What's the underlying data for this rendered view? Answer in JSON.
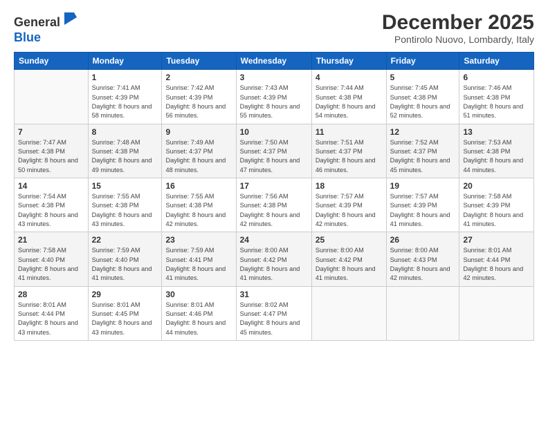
{
  "logo": {
    "general": "General",
    "blue": "Blue"
  },
  "header": {
    "month": "December 2025",
    "location": "Pontirolo Nuovo, Lombardy, Italy"
  },
  "weekdays": [
    "Sunday",
    "Monday",
    "Tuesday",
    "Wednesday",
    "Thursday",
    "Friday",
    "Saturday"
  ],
  "weeks": [
    [
      {
        "day": "",
        "sunrise": "",
        "sunset": "",
        "daylight": ""
      },
      {
        "day": "1",
        "sunrise": "Sunrise: 7:41 AM",
        "sunset": "Sunset: 4:39 PM",
        "daylight": "Daylight: 8 hours and 58 minutes."
      },
      {
        "day": "2",
        "sunrise": "Sunrise: 7:42 AM",
        "sunset": "Sunset: 4:39 PM",
        "daylight": "Daylight: 8 hours and 56 minutes."
      },
      {
        "day": "3",
        "sunrise": "Sunrise: 7:43 AM",
        "sunset": "Sunset: 4:39 PM",
        "daylight": "Daylight: 8 hours and 55 minutes."
      },
      {
        "day": "4",
        "sunrise": "Sunrise: 7:44 AM",
        "sunset": "Sunset: 4:38 PM",
        "daylight": "Daylight: 8 hours and 54 minutes."
      },
      {
        "day": "5",
        "sunrise": "Sunrise: 7:45 AM",
        "sunset": "Sunset: 4:38 PM",
        "daylight": "Daylight: 8 hours and 52 minutes."
      },
      {
        "day": "6",
        "sunrise": "Sunrise: 7:46 AM",
        "sunset": "Sunset: 4:38 PM",
        "daylight": "Daylight: 8 hours and 51 minutes."
      }
    ],
    [
      {
        "day": "7",
        "sunrise": "Sunrise: 7:47 AM",
        "sunset": "Sunset: 4:38 PM",
        "daylight": "Daylight: 8 hours and 50 minutes."
      },
      {
        "day": "8",
        "sunrise": "Sunrise: 7:48 AM",
        "sunset": "Sunset: 4:38 PM",
        "daylight": "Daylight: 8 hours and 49 minutes."
      },
      {
        "day": "9",
        "sunrise": "Sunrise: 7:49 AM",
        "sunset": "Sunset: 4:37 PM",
        "daylight": "Daylight: 8 hours and 48 minutes."
      },
      {
        "day": "10",
        "sunrise": "Sunrise: 7:50 AM",
        "sunset": "Sunset: 4:37 PM",
        "daylight": "Daylight: 8 hours and 47 minutes."
      },
      {
        "day": "11",
        "sunrise": "Sunrise: 7:51 AM",
        "sunset": "Sunset: 4:37 PM",
        "daylight": "Daylight: 8 hours and 46 minutes."
      },
      {
        "day": "12",
        "sunrise": "Sunrise: 7:52 AM",
        "sunset": "Sunset: 4:37 PM",
        "daylight": "Daylight: 8 hours and 45 minutes."
      },
      {
        "day": "13",
        "sunrise": "Sunrise: 7:53 AM",
        "sunset": "Sunset: 4:38 PM",
        "daylight": "Daylight: 8 hours and 44 minutes."
      }
    ],
    [
      {
        "day": "14",
        "sunrise": "Sunrise: 7:54 AM",
        "sunset": "Sunset: 4:38 PM",
        "daylight": "Daylight: 8 hours and 43 minutes."
      },
      {
        "day": "15",
        "sunrise": "Sunrise: 7:55 AM",
        "sunset": "Sunset: 4:38 PM",
        "daylight": "Daylight: 8 hours and 43 minutes."
      },
      {
        "day": "16",
        "sunrise": "Sunrise: 7:55 AM",
        "sunset": "Sunset: 4:38 PM",
        "daylight": "Daylight: 8 hours and 42 minutes."
      },
      {
        "day": "17",
        "sunrise": "Sunrise: 7:56 AM",
        "sunset": "Sunset: 4:38 PM",
        "daylight": "Daylight: 8 hours and 42 minutes."
      },
      {
        "day": "18",
        "sunrise": "Sunrise: 7:57 AM",
        "sunset": "Sunset: 4:39 PM",
        "daylight": "Daylight: 8 hours and 42 minutes."
      },
      {
        "day": "19",
        "sunrise": "Sunrise: 7:57 AM",
        "sunset": "Sunset: 4:39 PM",
        "daylight": "Daylight: 8 hours and 41 minutes."
      },
      {
        "day": "20",
        "sunrise": "Sunrise: 7:58 AM",
        "sunset": "Sunset: 4:39 PM",
        "daylight": "Daylight: 8 hours and 41 minutes."
      }
    ],
    [
      {
        "day": "21",
        "sunrise": "Sunrise: 7:58 AM",
        "sunset": "Sunset: 4:40 PM",
        "daylight": "Daylight: 8 hours and 41 minutes."
      },
      {
        "day": "22",
        "sunrise": "Sunrise: 7:59 AM",
        "sunset": "Sunset: 4:40 PM",
        "daylight": "Daylight: 8 hours and 41 minutes."
      },
      {
        "day": "23",
        "sunrise": "Sunrise: 7:59 AM",
        "sunset": "Sunset: 4:41 PM",
        "daylight": "Daylight: 8 hours and 41 minutes."
      },
      {
        "day": "24",
        "sunrise": "Sunrise: 8:00 AM",
        "sunset": "Sunset: 4:42 PM",
        "daylight": "Daylight: 8 hours and 41 minutes."
      },
      {
        "day": "25",
        "sunrise": "Sunrise: 8:00 AM",
        "sunset": "Sunset: 4:42 PM",
        "daylight": "Daylight: 8 hours and 41 minutes."
      },
      {
        "day": "26",
        "sunrise": "Sunrise: 8:00 AM",
        "sunset": "Sunset: 4:43 PM",
        "daylight": "Daylight: 8 hours and 42 minutes."
      },
      {
        "day": "27",
        "sunrise": "Sunrise: 8:01 AM",
        "sunset": "Sunset: 4:44 PM",
        "daylight": "Daylight: 8 hours and 42 minutes."
      }
    ],
    [
      {
        "day": "28",
        "sunrise": "Sunrise: 8:01 AM",
        "sunset": "Sunset: 4:44 PM",
        "daylight": "Daylight: 8 hours and 43 minutes."
      },
      {
        "day": "29",
        "sunrise": "Sunrise: 8:01 AM",
        "sunset": "Sunset: 4:45 PM",
        "daylight": "Daylight: 8 hours and 43 minutes."
      },
      {
        "day": "30",
        "sunrise": "Sunrise: 8:01 AM",
        "sunset": "Sunset: 4:46 PM",
        "daylight": "Daylight: 8 hours and 44 minutes."
      },
      {
        "day": "31",
        "sunrise": "Sunrise: 8:02 AM",
        "sunset": "Sunset: 4:47 PM",
        "daylight": "Daylight: 8 hours and 45 minutes."
      },
      {
        "day": "",
        "sunrise": "",
        "sunset": "",
        "daylight": ""
      },
      {
        "day": "",
        "sunrise": "",
        "sunset": "",
        "daylight": ""
      },
      {
        "day": "",
        "sunrise": "",
        "sunset": "",
        "daylight": ""
      }
    ]
  ]
}
